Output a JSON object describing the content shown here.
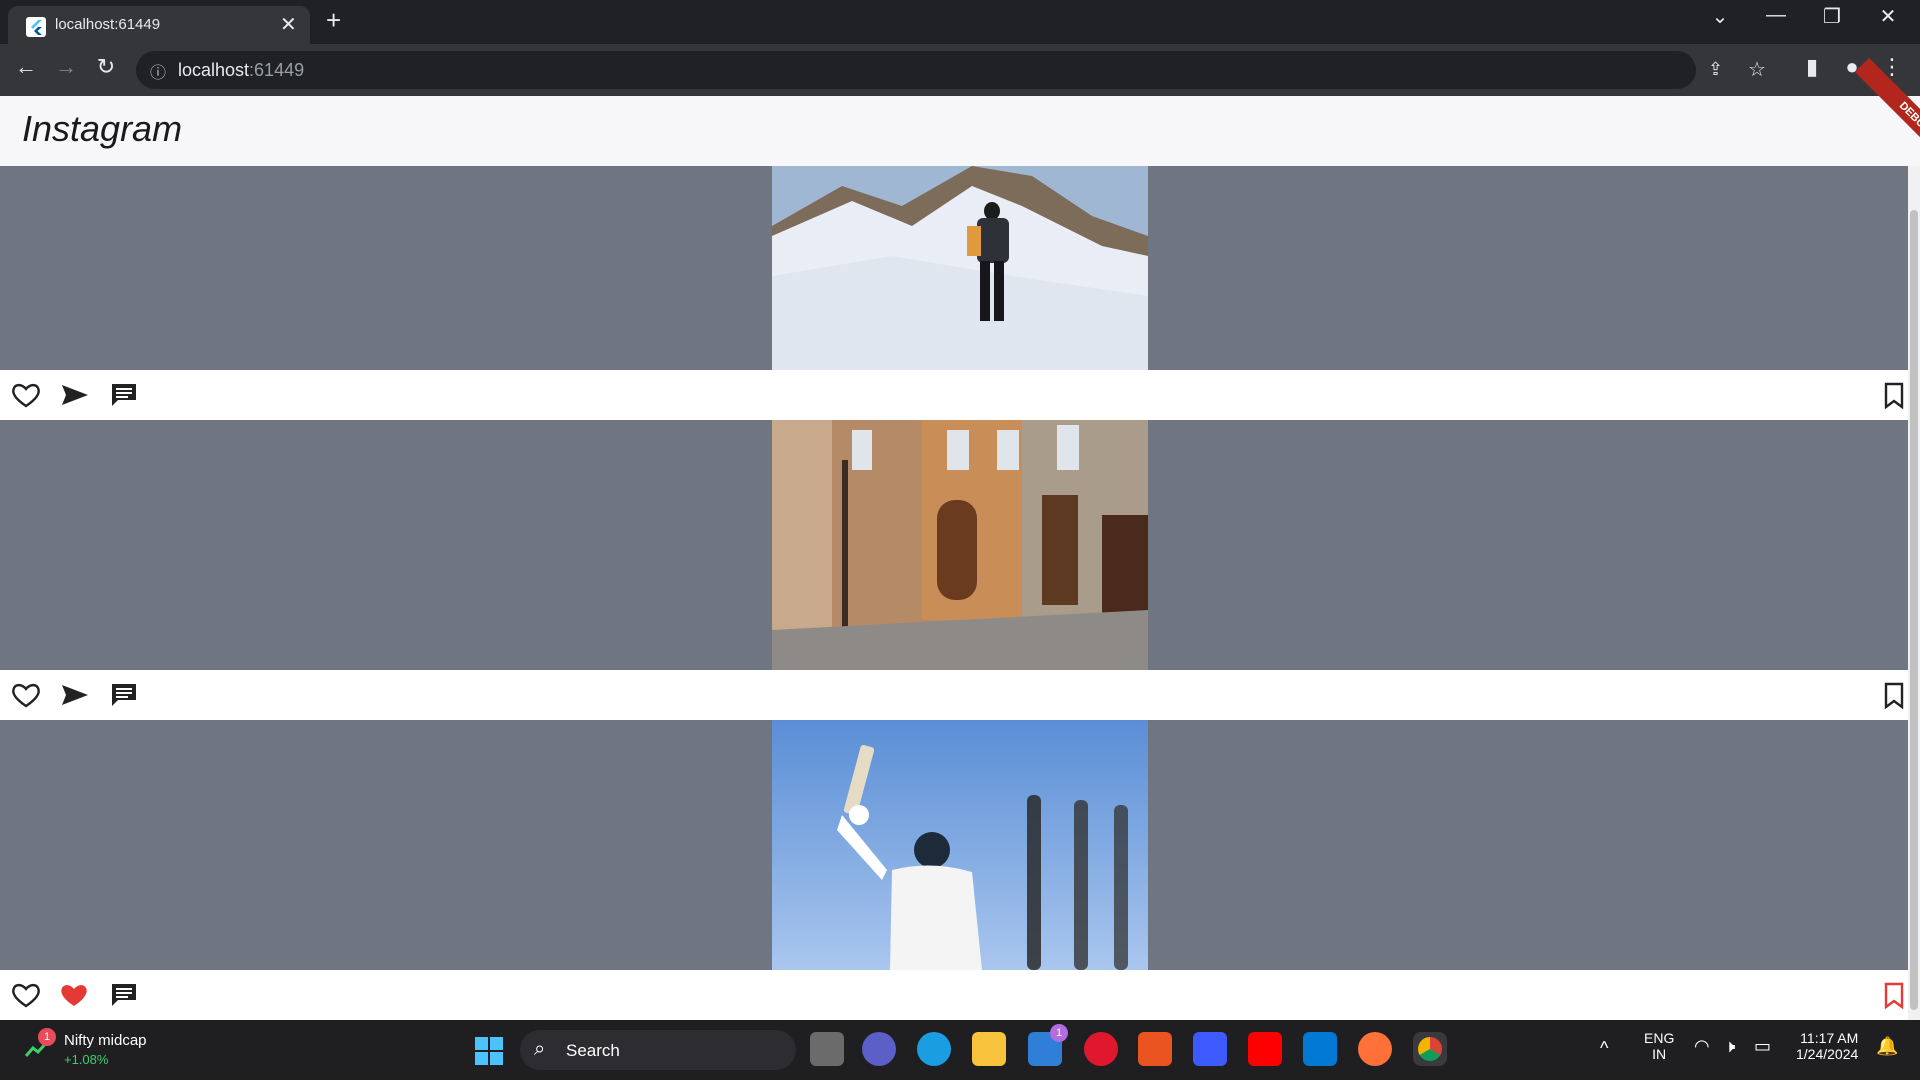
{
  "browser": {
    "tab_title": "localhost:61449",
    "url_host": "localhost",
    "url_port": ":61449",
    "new_tab": "+",
    "close_tab": "✕"
  },
  "app": {
    "title": "Instagram",
    "debug_label": "DEBUG"
  },
  "posts": [
    {
      "image": "mountaineer-on-snow",
      "liked": false,
      "saved": false
    },
    {
      "image": "old-town-street",
      "liked": false,
      "saved": false
    },
    {
      "image": "cricketer-raising-bat",
      "liked": true,
      "saved": true
    }
  ],
  "taskbar": {
    "widget_name": "Nifty midcap",
    "widget_change": "+1.08%",
    "widget_badge": "1",
    "search_placeholder": "Search",
    "mail_badge": "1",
    "lang_line1": "ENG",
    "lang_line2": "IN",
    "time": "11:17 AM",
    "date": "1/24/2024"
  },
  "colors": {
    "like_active": "#e53935",
    "media_bg": "#6f7581",
    "saved_active": "#e53935"
  }
}
